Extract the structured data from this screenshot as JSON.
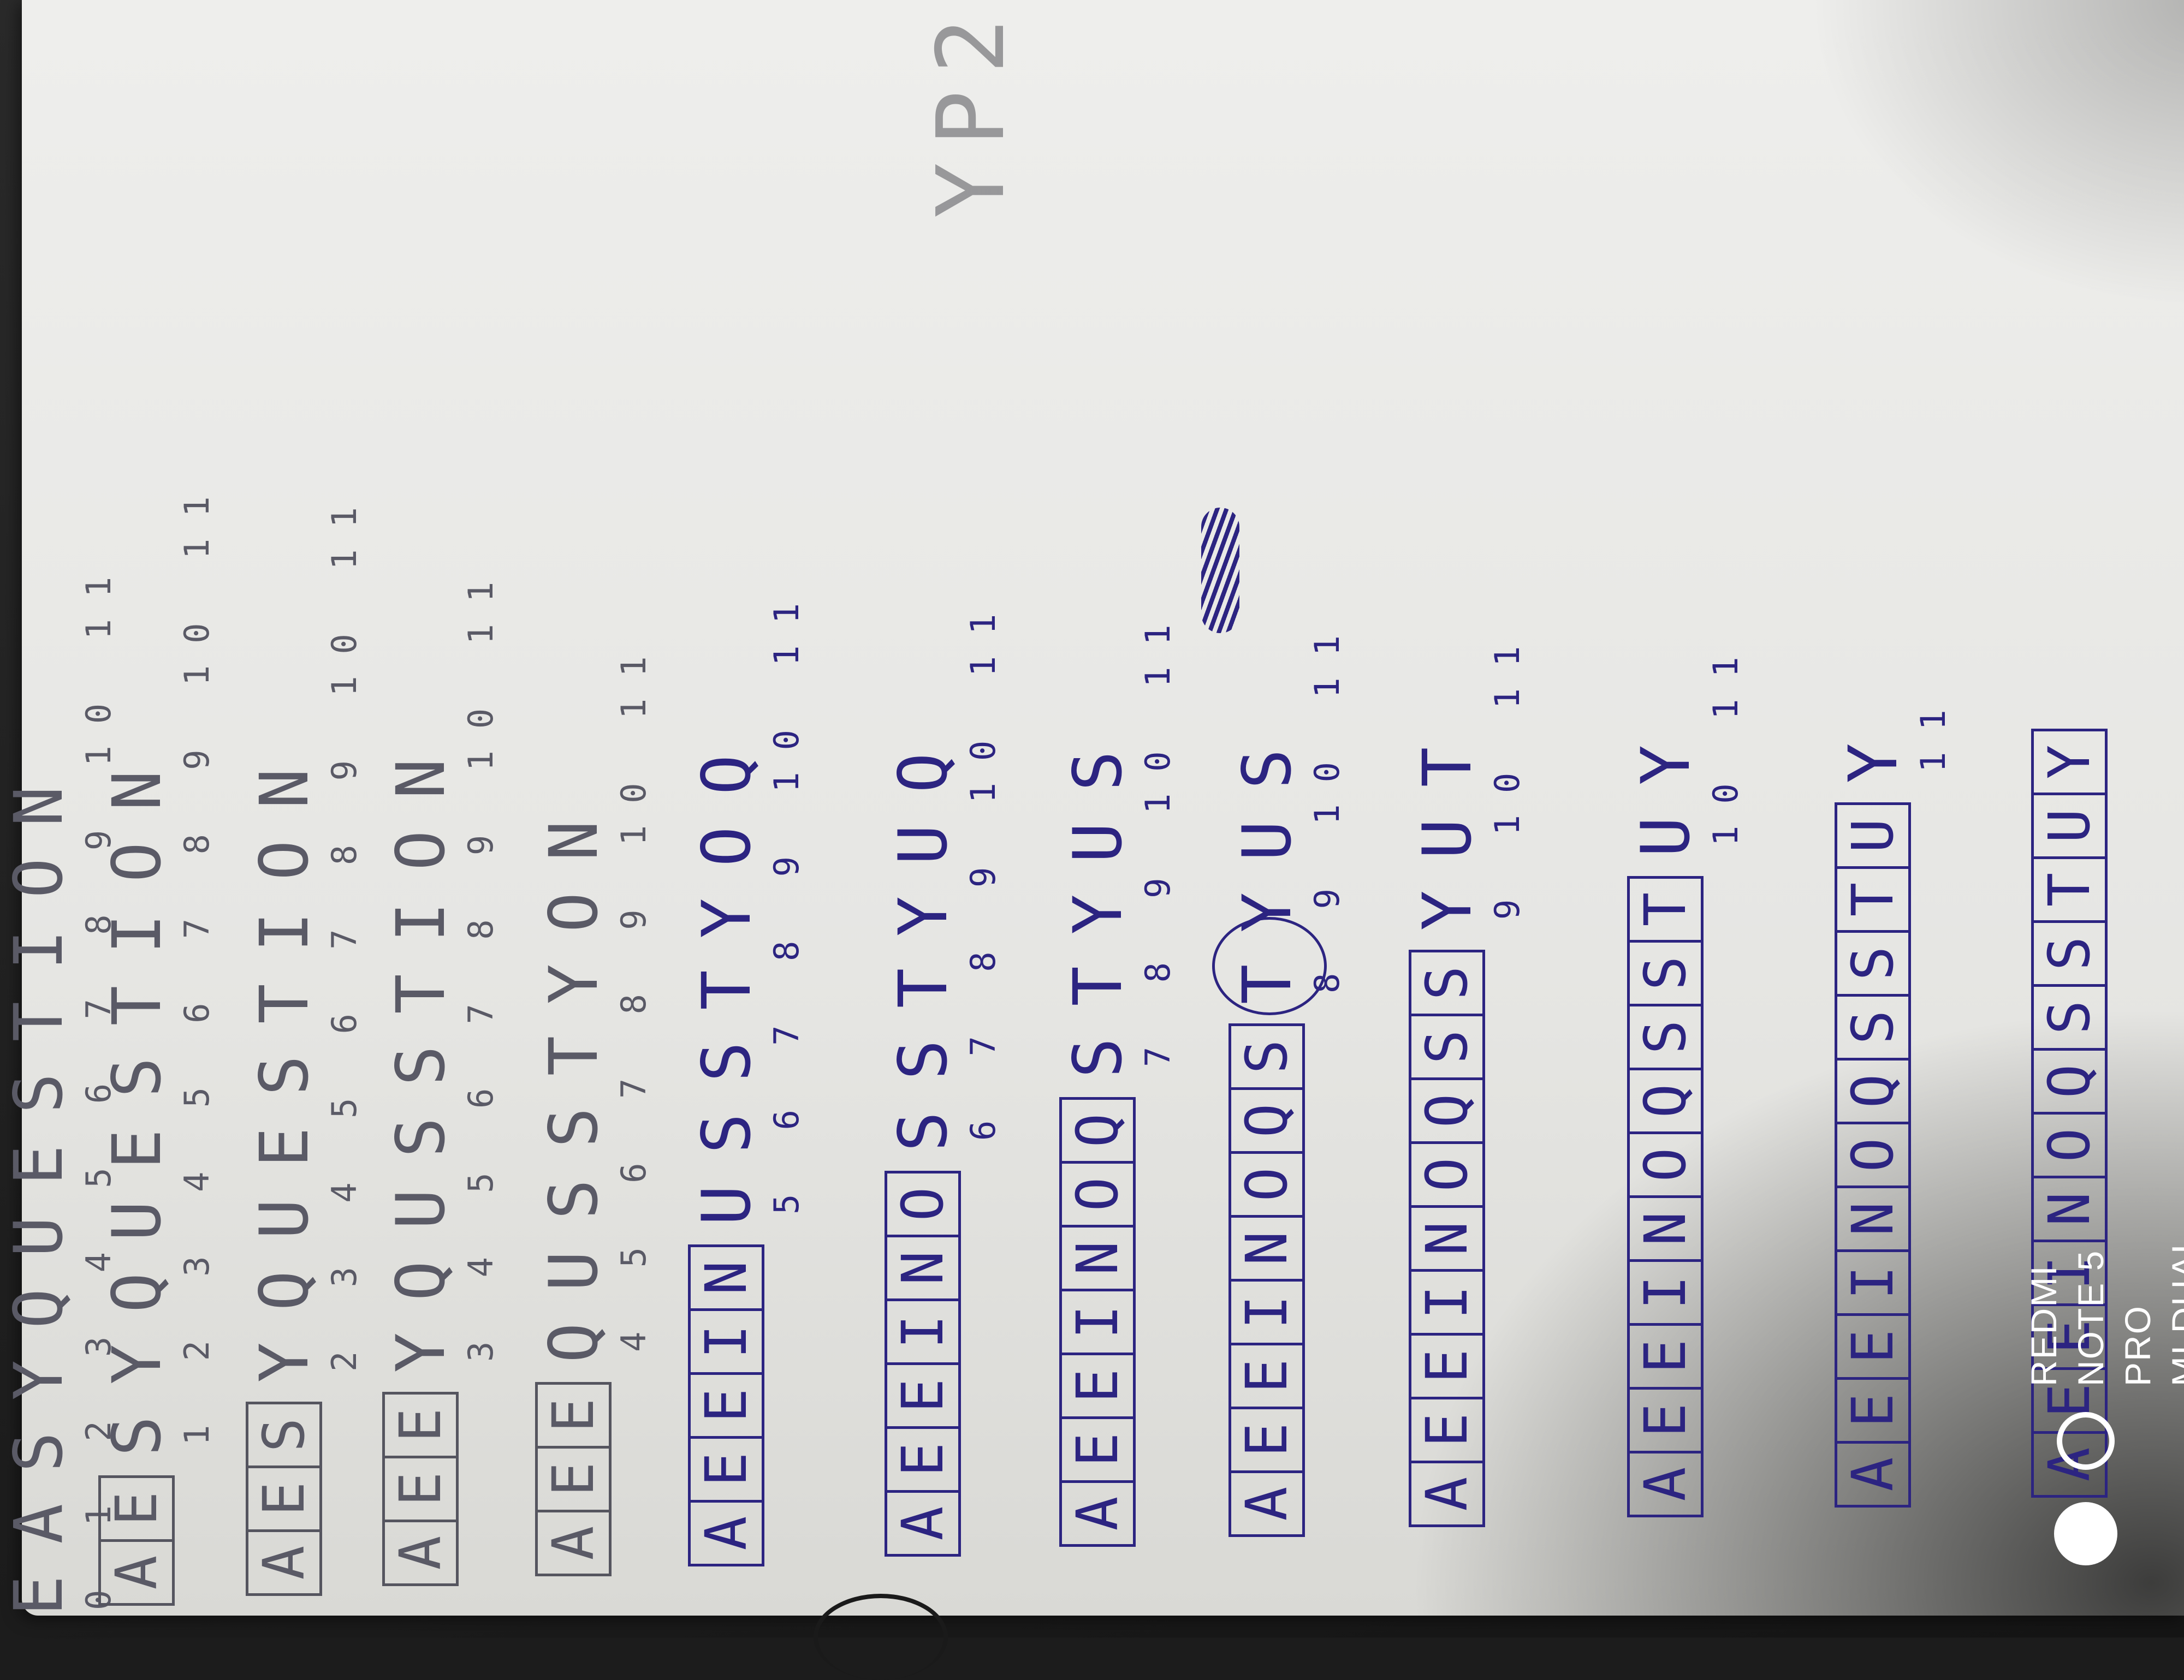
{
  "photo": {
    "subject": "handwritten notebook page",
    "colors": {
      "paper": "#e9e9e6",
      "pencil": "#5a5a66",
      "ink": "#2c2481"
    }
  },
  "notes": {
    "side_note": "YP2",
    "rows": [
      {
        "kind": "text",
        "style": "pencil",
        "letters": "EASYQUESTION",
        "indices": "0 1 2 3 4 5 6 7 8 9 10 11"
      },
      {
        "kind": "boxed-text",
        "style": "pencil",
        "boxed": [
          "A",
          "E"
        ],
        "rest": "SYQUESTION",
        "indices": "1 2 3 4 5 6 7 8 9 10 11"
      },
      {
        "kind": "boxed-text",
        "style": "pencil",
        "boxed": [
          "A",
          "E",
          "S"
        ],
        "rest": "YQUESTION",
        "indices": "2 3 4 5 6 7 8 9 10 11"
      },
      {
        "kind": "boxed-text",
        "style": "pencil",
        "boxed": [
          "A",
          "E",
          "E"
        ],
        "rest": "YQUSSTION",
        "indices": "3 4 5 6 7 8 9 10 11"
      },
      {
        "kind": "boxed-text",
        "style": "pencil",
        "boxed": [
          "A",
          "E",
          "E"
        ],
        "rest": "QUSSTYON",
        "indices": "4 5 6 7 8 9 10 11"
      },
      {
        "kind": "boxed-text",
        "style": "ink",
        "boxed": [
          "A",
          "E",
          "E",
          "I",
          "N"
        ],
        "rest": "USSTYOQ",
        "indices": "5 6 7 8 9 10 11"
      },
      {
        "kind": "boxed-text",
        "style": "ink",
        "boxed": [
          "A",
          "E",
          "E",
          "I",
          "N",
          "O"
        ],
        "rest": "SSTYUQ",
        "indices": "6 7 8 9 10 11"
      },
      {
        "kind": "boxed-text",
        "style": "ink",
        "boxed": [
          "A",
          "E",
          "E",
          "I",
          "N",
          "O",
          "Q"
        ],
        "rest": "STYUS",
        "indices": "7 8 9 10 11"
      },
      {
        "kind": "boxed-text",
        "style": "ink",
        "boxed": [
          "A",
          "E",
          "E",
          "I",
          "N",
          "O",
          "Q",
          "S"
        ],
        "rest": "TYUS",
        "indices": "8 9 10 11"
      },
      {
        "kind": "boxed-text",
        "style": "ink",
        "boxed": [
          "A",
          "E",
          "E",
          "I",
          "N",
          "O",
          "Q",
          "S",
          "S"
        ],
        "rest": "YUT",
        "indices": "9 10 11"
      },
      {
        "kind": "boxed-text",
        "style": "ink",
        "boxed": [
          "A",
          "E",
          "E",
          "I",
          "N",
          "O",
          "Q",
          "S",
          "S",
          "T"
        ],
        "rest": "UY",
        "indices": "10 11"
      },
      {
        "kind": "boxed-text",
        "style": "ink",
        "boxed": [
          "A",
          "E",
          "E",
          "I",
          "N",
          "O",
          "Q",
          "S",
          "S",
          "T",
          "U"
        ],
        "rest": "Y",
        "indices": "11"
      },
      {
        "kind": "boxed-text",
        "style": "ink",
        "boxed": [
          "A",
          "E",
          "E",
          "I",
          "N",
          "O",
          "Q",
          "S",
          "S",
          "T",
          "U",
          "Y"
        ],
        "rest": "",
        "indices": ""
      }
    ]
  },
  "watermark": {
    "line1": "REDMI NOTE 5 PRO",
    "line2": "MI DUAL CAMERA"
  }
}
